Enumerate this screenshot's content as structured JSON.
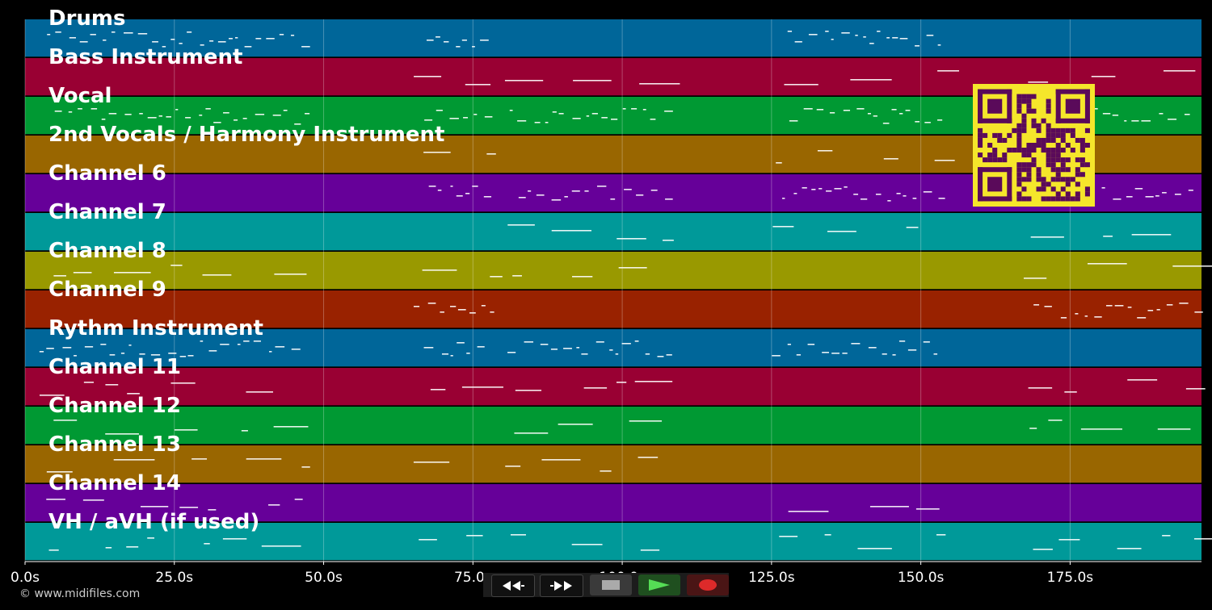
{
  "tracks": [
    {
      "name": "Drums",
      "color": "#006699"
    },
    {
      "name": "Bass Instrument",
      "color": "#990033"
    },
    {
      "name": "Vocal",
      "color": "#009933"
    },
    {
      "name": "2nd Vocals / Harmony Instrument",
      "color": "#996600"
    },
    {
      "name": "Channel 6",
      "color": "#660099"
    },
    {
      "name": "Channel 7",
      "color": "#009999"
    },
    {
      "name": "Channel 8",
      "color": "#999900"
    },
    {
      "name": "Channel 9",
      "color": "#992200"
    },
    {
      "name": "Rythm Instrument",
      "color": "#006699"
    },
    {
      "name": "Channel 11",
      "color": "#990033"
    },
    {
      "name": "Channel 12",
      "color": "#009933"
    },
    {
      "name": "Channel 13",
      "color": "#996600"
    },
    {
      "name": "Channel 14",
      "color": "#660099"
    },
    {
      "name": "VH / aVH (if used)",
      "color": "#009999"
    }
  ],
  "timeline": {
    "ticks": [
      "0.0s",
      "25.0s",
      "50.0s",
      "75.0s",
      "100.0s",
      "125.0s",
      "150.0s",
      "175.0s"
    ],
    "tick_values": [
      0,
      25,
      50,
      75,
      100,
      125,
      150,
      175
    ],
    "duration_s": 197
  },
  "copyright": "© www.midifiles.com",
  "transport": {
    "rewind": "rewind-icon",
    "fast_forward": "fast-forward-icon",
    "stop": "stop-icon",
    "play": "play-icon",
    "record": "record-icon"
  },
  "qr_code": {
    "fg": "#5a0a5a",
    "bg": "#f5e62b"
  }
}
